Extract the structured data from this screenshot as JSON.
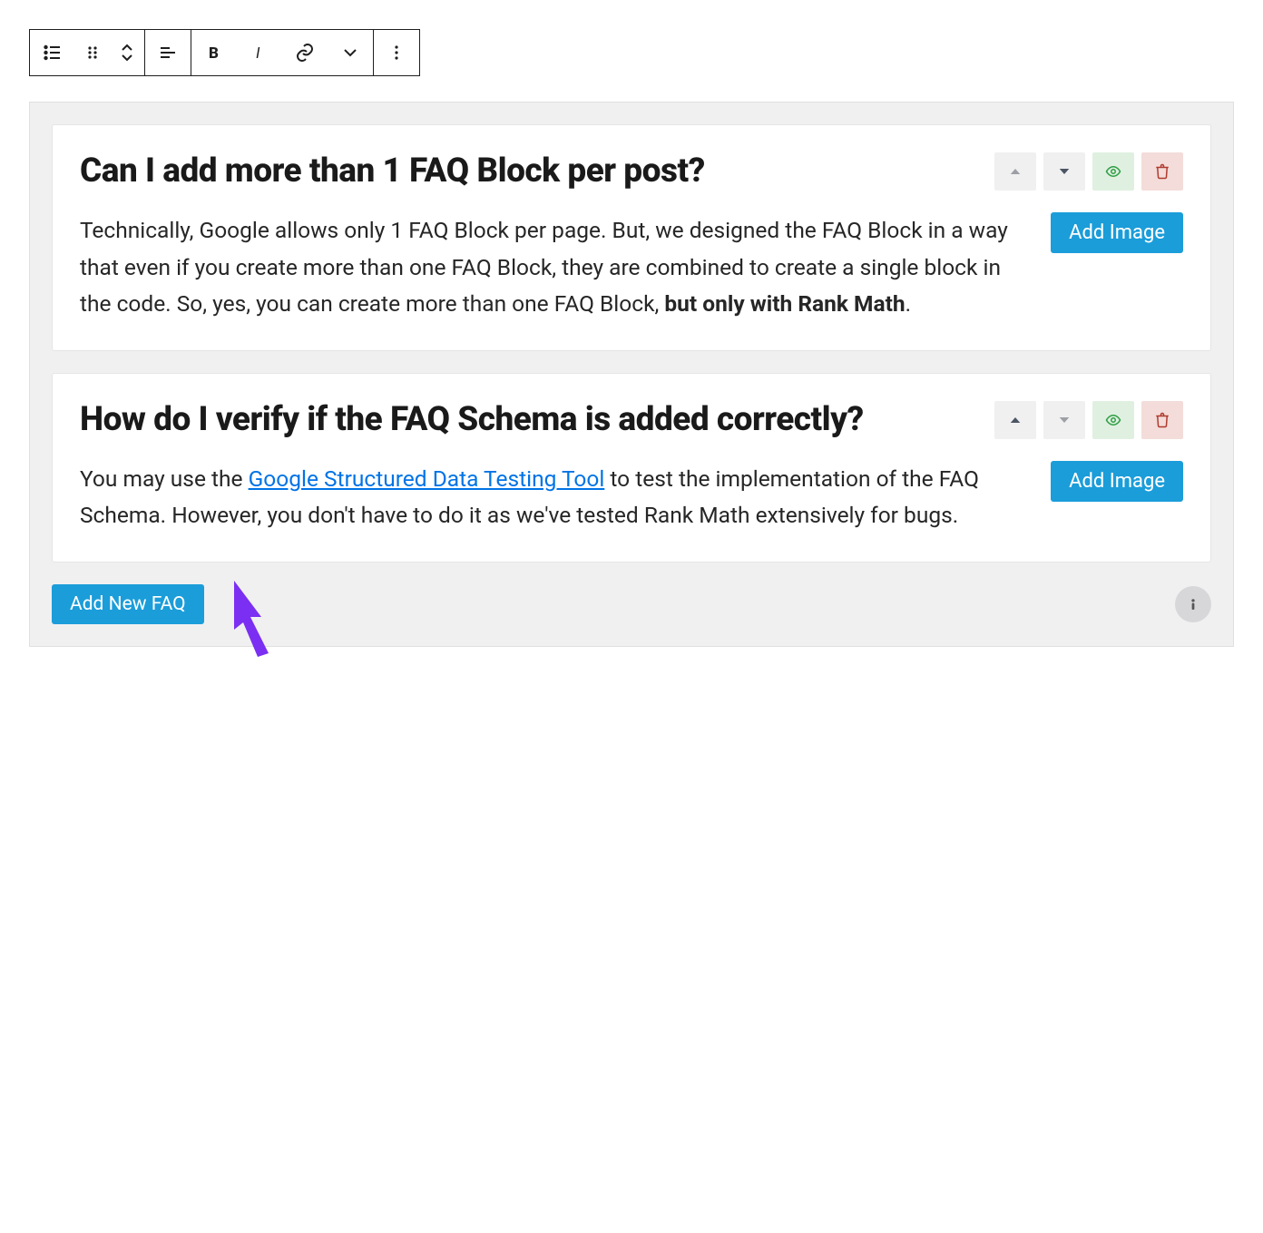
{
  "toolbar": {
    "groups": [
      [
        "ordered-list-icon",
        "drag-handle-icon",
        "sort-icon"
      ],
      [
        "align-left-icon"
      ],
      [
        "bold-icon",
        "italic-icon",
        "link-icon",
        "chevron-down-icon"
      ],
      [
        "more-icon"
      ]
    ]
  },
  "faqs": [
    {
      "question": "Can I add more than 1 FAQ Block per post?",
      "answer_pre": "Technically, Google allows only 1 FAQ Block per page. But, we designed the FAQ Block in a way that even if you create more than one FAQ Block, they are combined to create a single block in the code. So, yes, you can create more than one FAQ Block, ",
      "answer_bold": "but only with Rank Math",
      "answer_post": ".",
      "move_up_enabled": false,
      "move_down_enabled": true,
      "add_image_label": "Add Image"
    },
    {
      "question": "How do I verify if the FAQ Schema is added correctly?",
      "answer_pre": "You may use the ",
      "link_text": "Google Structured Data Testing Tool",
      "answer_post": " to test the implementation of the FAQ Schema. However, you don't have to do it as we've tested Rank Math extensively for bugs.",
      "move_up_enabled": true,
      "move_down_enabled": false,
      "add_image_label": "Add Image"
    }
  ],
  "buttons": {
    "add_new_faq": "Add New FAQ"
  }
}
